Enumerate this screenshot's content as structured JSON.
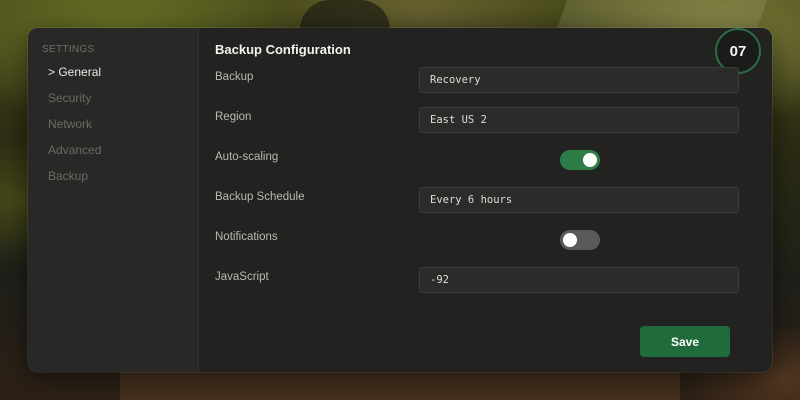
{
  "sidebar": {
    "heading": "SETTINGS",
    "items": [
      {
        "label": "> General"
      },
      {
        "label": "Security"
      },
      {
        "label": "Network"
      },
      {
        "label": "Advanced"
      },
      {
        "label": "Backup"
      }
    ]
  },
  "main": {
    "title": "Backup Configuration",
    "badge": "07",
    "fields": {
      "backup": {
        "label": "Backup",
        "value": "Recovery"
      },
      "region": {
        "label": "Region",
        "value": "East US 2"
      },
      "auto_scaling": {
        "label": "Auto-scaling",
        "enabled": true
      },
      "backup_schedule": {
        "label": "Backup Schedule",
        "value": "Every 6 hours"
      },
      "notifications": {
        "label": "Notifications",
        "enabled": false
      },
      "javascript": {
        "label": "JavaScript",
        "value": "-92"
      }
    },
    "save_label": "Save"
  },
  "colors": {
    "accent": "#2e7d46",
    "save_button": "#1f6b3c",
    "panel": "#222220",
    "sidebar": "#282826",
    "toggle_off": "#5a5a58"
  }
}
